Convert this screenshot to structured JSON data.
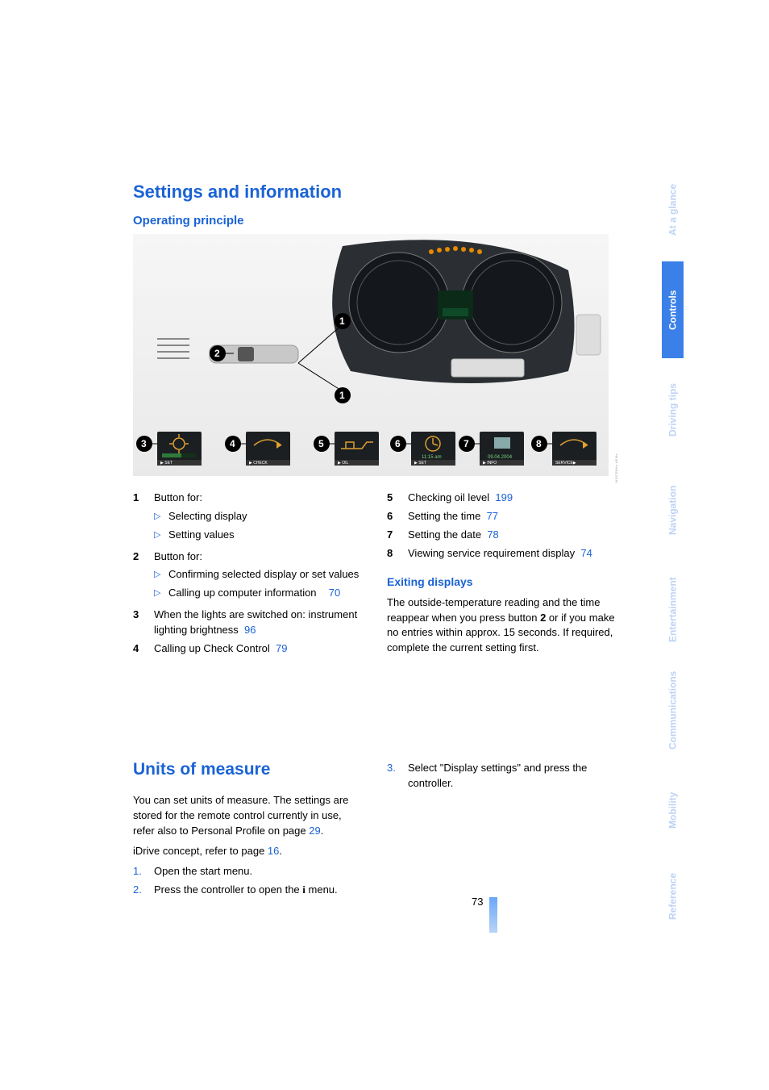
{
  "headings": {
    "h1_settings": "Settings and information",
    "h2_operating": "Operating principle",
    "h3_exiting": "Exiting displays",
    "h1_units": "Units of measure"
  },
  "left_list": [
    {
      "num": "1",
      "text": "Button for:",
      "sub": [
        {
          "text": "Selecting display"
        },
        {
          "text": "Setting values"
        }
      ]
    },
    {
      "num": "2",
      "text": "Button for:",
      "sub": [
        {
          "text": "Confirming selected display or set values"
        },
        {
          "text": "Calling up computer information",
          "page": "70"
        }
      ]
    },
    {
      "num": "3",
      "text": "When the lights are switched on: instrument lighting brightness",
      "page": "96"
    },
    {
      "num": "4",
      "text": "Calling up Check Control",
      "page": "79"
    }
  ],
  "right_list": [
    {
      "num": "5",
      "text": "Checking oil level",
      "page": "199"
    },
    {
      "num": "6",
      "text": "Setting the time",
      "page": "77"
    },
    {
      "num": "7",
      "text": "Setting the date",
      "page": "78"
    },
    {
      "num": "8",
      "text": "Viewing service requirement display",
      "page": "74"
    }
  ],
  "exiting_para_pre": "The outside-temperature reading and the time reappear when you press button ",
  "exiting_button_num": "2",
  "exiting_para_post": " or if you make no entries within approx. 15 seconds. If required, complete the current setting first.",
  "units": {
    "para1_pre": "You can set units of measure. The settings are stored for the remote control currently in use, refer also to Personal Profile on page ",
    "para1_page": "29",
    "para1_post": ".",
    "para2_pre": "iDrive concept, refer to page ",
    "para2_page": "16",
    "para2_post": ".",
    "steps": [
      {
        "num": "1.",
        "text": "Open the start menu."
      },
      {
        "num": "2.",
        "text_pre": "Press the controller to open the ",
        "icon_label": "i",
        "text_post": " menu."
      }
    ],
    "step3": {
      "num": "3.",
      "text": "Select \"Display settings\" and press the controller."
    }
  },
  "tabs": [
    {
      "label": "At a glance",
      "active": false
    },
    {
      "label": "Controls",
      "active": true
    },
    {
      "label": "Driving tips",
      "active": false
    },
    {
      "label": "Navigation",
      "active": false
    },
    {
      "label": "Entertainment",
      "active": false
    },
    {
      "label": "Communications",
      "active": false
    },
    {
      "label": "Mobility",
      "active": false
    },
    {
      "label": "Reference",
      "active": false
    }
  ],
  "page_number": "73",
  "figure": {
    "callouts": [
      "1",
      "2",
      "1",
      "3",
      "4",
      "5",
      "6",
      "7",
      "8"
    ],
    "bottom_labels": [
      "SET",
      "CHECK",
      "OIL",
      "SET",
      "INFO",
      "SERVICE"
    ]
  },
  "img_side_code": "WKCSBHr-bEMs"
}
